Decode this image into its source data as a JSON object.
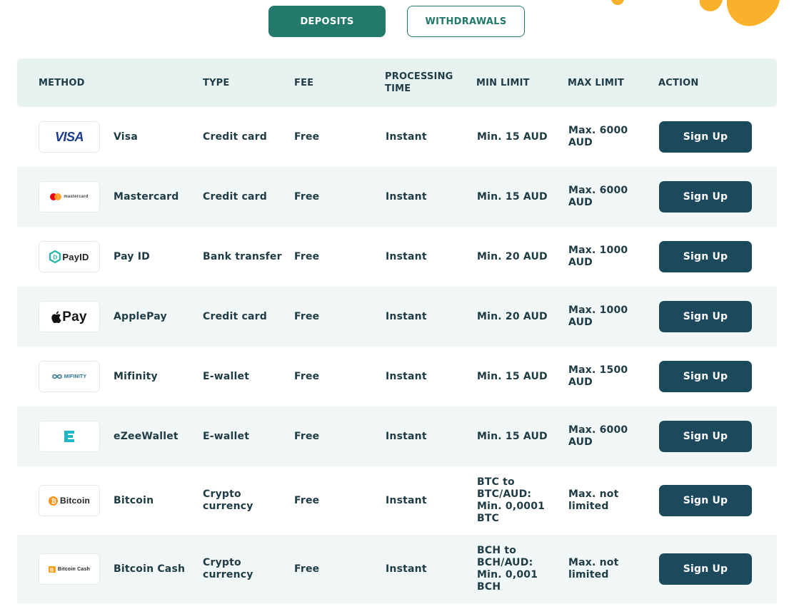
{
  "colors": {
    "primary": "#237a6c",
    "button": "#1c4a5c",
    "header_bg": "#e8f3f1",
    "row_alt_bg": "#f0f7f6",
    "text": "#1f3b45",
    "accent_blob": "#f9b02b"
  },
  "tabs": [
    {
      "label": "DEPOSITS",
      "active": true
    },
    {
      "label": "WITHDRAWALS",
      "active": false
    }
  ],
  "headers": {
    "method": "METHOD",
    "type": "TYPE",
    "fee": "FEE",
    "processing_time": "PROCESSING TIME",
    "min_limit": "MIN LIMIT",
    "max_limit": "MAX LIMIT",
    "action": "ACTION"
  },
  "rows": [
    {
      "logo": "visa-logo",
      "logo_text": "VISA",
      "name": "Visa",
      "type": "Credit card",
      "fee": "Free",
      "time": "Instant",
      "min": "Min. 15 AUD",
      "max": "Max. 6000 AUD",
      "action": "Sign Up"
    },
    {
      "logo": "mastercard-logo",
      "logo_text": "mastercard",
      "name": "Mastercard",
      "type": "Credit card",
      "fee": "Free",
      "time": "Instant",
      "min": "Min. 15 AUD",
      "max": "Max. 6000 AUD",
      "action": "Sign Up"
    },
    {
      "logo": "payid-logo",
      "logo_text": "PayID",
      "name": "Pay ID",
      "type": "Bank transfer",
      "fee": "Free",
      "time": "Instant",
      "min": "Min. 20 AUD",
      "max": "Max. 1000 AUD",
      "action": "Sign Up"
    },
    {
      "logo": "applepay-logo",
      "logo_text": "Pay",
      "name": "ApplePay",
      "type": "Credit card",
      "fee": "Free",
      "time": "Instant",
      "min": "Min. 20 AUD",
      "max": "Max. 1000 AUD",
      "action": "Sign Up"
    },
    {
      "logo": "mifinity-logo",
      "logo_text": "MIFINITY",
      "name": "Mifinity",
      "type": "E-wallet",
      "fee": "Free",
      "time": "Instant",
      "min": "Min. 15 AUD",
      "max": "Max. 1500 AUD",
      "action": "Sign Up"
    },
    {
      "logo": "ezeewallet-logo",
      "logo_text": "",
      "name": "eZeeWallet",
      "type": "E-wallet",
      "fee": "Free",
      "time": "Instant",
      "min": "Min. 15 AUD",
      "max": "Max. 6000 AUD",
      "action": "Sign Up"
    },
    {
      "logo": "bitcoin-logo",
      "logo_text": "Bitcoin",
      "name": "Bitcoin",
      "type": "Crypto currency",
      "fee": "Free",
      "time": "Instant",
      "min": "BTC to BTC/AUD: Min. 0,0001 BTC",
      "max": "Max. not limited",
      "action": "Sign Up"
    },
    {
      "logo": "bitcoin-cash-logo",
      "logo_text": "Bitcoin Cash",
      "name": "Bitcoin Cash",
      "type": "Crypto currency",
      "fee": "Free",
      "time": "Instant",
      "min": "BCH to BCH/AUD: Min. 0,001 BCH",
      "max": "Max. not limited",
      "action": "Sign Up"
    }
  ]
}
